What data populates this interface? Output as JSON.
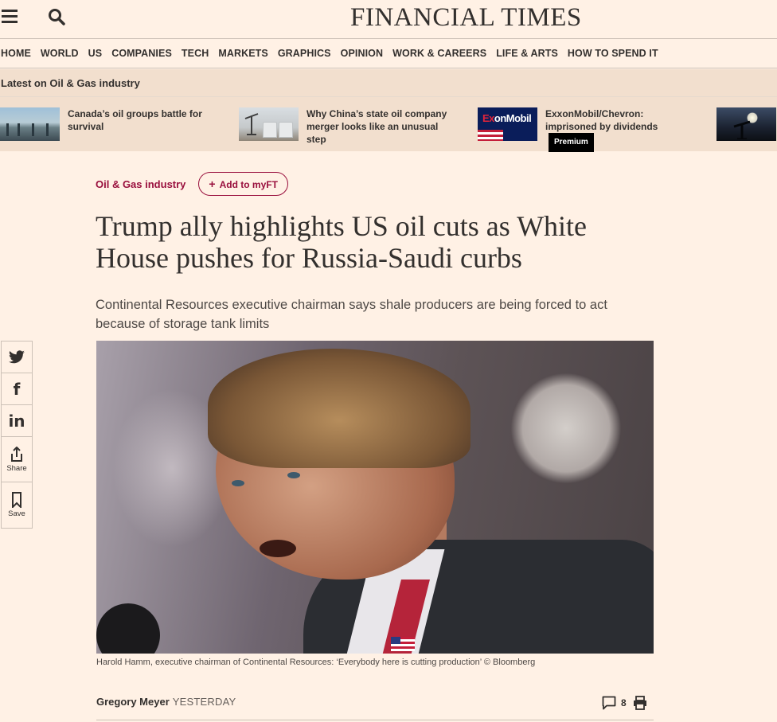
{
  "header": {
    "logo_text": "FINANCIAL TIMES",
    "menu_icon": "hamburger-menu-icon",
    "search_icon": "search-icon"
  },
  "nav": {
    "items": [
      {
        "label": "HOME"
      },
      {
        "label": "WORLD"
      },
      {
        "label": "US"
      },
      {
        "label": "COMPANIES"
      },
      {
        "label": "TECH"
      },
      {
        "label": "MARKETS"
      },
      {
        "label": "GRAPHICS"
      },
      {
        "label": "OPINION"
      },
      {
        "label": "WORK & CAREERS"
      },
      {
        "label": "LIFE & ARTS"
      },
      {
        "label": "HOW TO SPEND IT"
      }
    ]
  },
  "latest": {
    "title": "Latest on Oil & Gas industry",
    "stories": [
      {
        "headline": "Canada’s oil groups battle for survival"
      },
      {
        "headline": "Why China’s state oil company merger looks like an unusual step"
      },
      {
        "headline": "ExxonMobil/Chevron: imprisoned by dividends",
        "badge": "Premium",
        "thumb_text_a": "E",
        "thumb_text_b": "x",
        "thumb_text_c": "onMobil"
      },
      {
        "headline": ""
      }
    ]
  },
  "article": {
    "topic": "Oil & Gas industry",
    "myft_label": "Add to myFT",
    "headline": "Trump ally highlights US oil cuts as White House pushes for Russia-Saudi curbs",
    "standfirst": "Continental Resources executive chairman says shale producers are being forced to act because of storage tank limits",
    "caption": "Harold Hamm, executive chairman of Continental Resources: ‘Everybody here is cutting production’ © Bloomberg",
    "author": "Gregory Meyer",
    "date": "YESTERDAY",
    "comment_count": "8"
  },
  "share": {
    "share_label": "Share",
    "save_label": "Save",
    "linkedin_text": "in",
    "facebook_text": "f"
  },
  "colors": {
    "background": "#fff1e5",
    "latest_bar": "#f2dfce",
    "claret": "#990f3d",
    "text": "#33302e"
  }
}
